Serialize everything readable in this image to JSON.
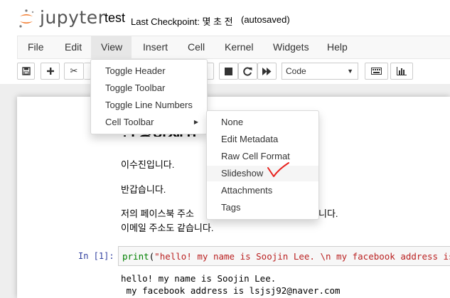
{
  "header": {
    "logo_text": "jupyter",
    "notebook_title": "test",
    "checkpoint": "Last Checkpoint: 몇 초 전",
    "autosave_status": "(autosaved)"
  },
  "menubar": {
    "items": [
      "File",
      "Edit",
      "View",
      "Insert",
      "Cell",
      "Kernel",
      "Widgets",
      "Help"
    ],
    "active": "View"
  },
  "toolbar": {
    "cell_type": "Code",
    "partial_label": "n",
    "icons": [
      "save-icon",
      "add-icon",
      "cut-icon",
      "stop-icon",
      "restart-icon",
      "run-all-icon",
      "keyboard-icon",
      "bar-chart-icon"
    ]
  },
  "view_menu": {
    "items": [
      "Toggle Header",
      "Toggle Toolbar",
      "Toggle Line Numbers",
      "Cell Toolbar"
    ]
  },
  "cell_toolbar_menu": {
    "items": [
      "None",
      "Edit Metadata",
      "Raw Cell Format",
      "Slideshow",
      "Attachments",
      "Tags"
    ],
    "highlighted": "Slideshow"
  },
  "notebook": {
    "heading_partial": "안녕하세요",
    "md_line1": "이수진입니다.",
    "md_line2": "반갑습니다.",
    "md_line3_start": "저의 페이스북 주소",
    "md_line3_end": "니다.",
    "md_line4": "이메일 주소도 같습니다.",
    "prompt": "In [1]:",
    "code_func": "print",
    "code_paren": "(",
    "code_string": "\"hello! my name is Soojin Lee. \\n my facebook address is lsj",
    "output_line1": "hello! my name is Soojin Lee.",
    "output_line2": " my facebook address is lsjsj92@naver.com"
  },
  "colors": {
    "menubar_bg": "#f8f8f8",
    "prompt_color": "#303f9f",
    "checkmark": "#e8231f",
    "logo_orange": "#f37726"
  }
}
